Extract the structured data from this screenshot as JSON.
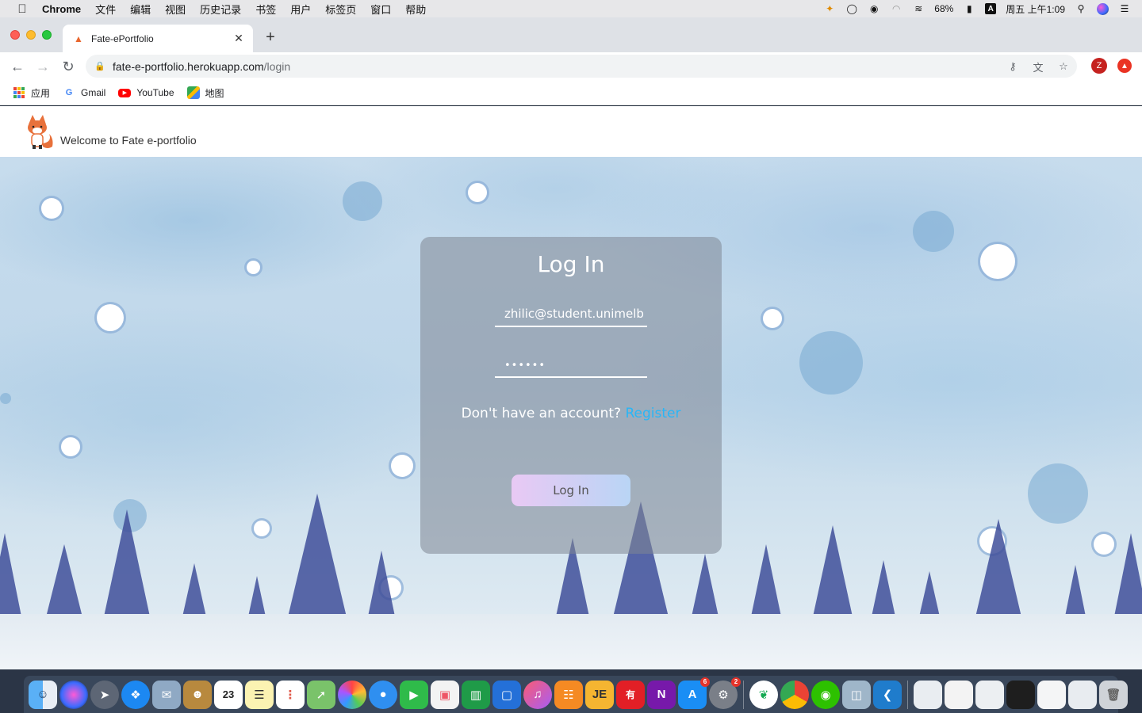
{
  "menubar": {
    "app_name": "Chrome",
    "items": [
      "文件",
      "编辑",
      "视图",
      "历史记录",
      "书签",
      "用户",
      "标签页",
      "窗口",
      "帮助"
    ],
    "battery": "68%",
    "input_method": "A",
    "clock": "周五 上午1:09"
  },
  "browser": {
    "tab_title": "Fate-ePortfolio",
    "url_host": "fate-e-portfolio.herokuapp.com",
    "url_path": "/login",
    "profile_initial": "Z",
    "bookmarks": [
      {
        "label": "应用",
        "icon": "apps-grid-icon"
      },
      {
        "label": "Gmail",
        "icon": "google-icon"
      },
      {
        "label": "YouTube",
        "icon": "youtube-icon"
      },
      {
        "label": "地图",
        "icon": "maps-icon"
      }
    ]
  },
  "site": {
    "title": "Welcome to Fate e-portfolio"
  },
  "login": {
    "heading": "Log In",
    "email_value": "zhilic@student.unimelb",
    "password_value": "••••••",
    "register_prompt": "Don't have an account?",
    "register_link": "Register",
    "submit_label": "Log In"
  },
  "dock": {
    "calendar_day": "23",
    "appstore_badge": "6",
    "settings_badge": "2"
  },
  "colors": {
    "register_link": "#29b6f6",
    "button_gradient_start": "#e9c9f4",
    "button_gradient_end": "#b9d5f5"
  }
}
